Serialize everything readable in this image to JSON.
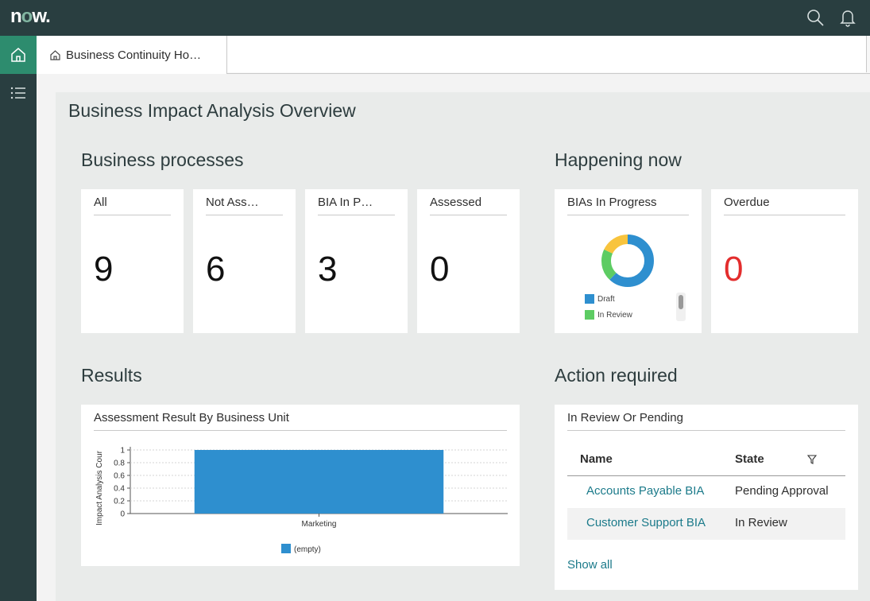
{
  "header": {
    "logo": {
      "n": "n",
      "o": "o",
      "w": "w."
    },
    "icons": [
      "search-icon",
      "bell-icon"
    ]
  },
  "rail": {
    "items": [
      "home-icon",
      "list-icon"
    ]
  },
  "tab": {
    "label": "Business Continuity Ho…"
  },
  "page": {
    "title": "Business Impact Analysis Overview"
  },
  "business_processes": {
    "title": "Business processes",
    "cards": [
      {
        "label": "All",
        "value": "9"
      },
      {
        "label": "Not Ass…",
        "value": "6"
      },
      {
        "label": "BIA In P…",
        "value": "3"
      },
      {
        "label": "Assessed",
        "value": "0"
      }
    ]
  },
  "happening_now": {
    "title": "Happening now",
    "bias_in_progress": {
      "label": "BIAs In Progress",
      "legend": [
        "Draft",
        "In Review"
      ]
    },
    "overdue": {
      "label": "Overdue",
      "value": "0"
    }
  },
  "results": {
    "title": "Results",
    "card_title": "Assessment Result By Business Unit",
    "chart_data": {
      "type": "bar",
      "categories": [
        "Marketing"
      ],
      "series": [
        {
          "name": "(empty)",
          "values": [
            1
          ]
        }
      ],
      "ylabel": "Impact Analysis Cour",
      "ylim": [
        0,
        1
      ],
      "yticks": [
        "0",
        "0.2",
        "0.4",
        "0.6",
        "0.8",
        "1"
      ],
      "grid": true,
      "legend": "bottom"
    }
  },
  "action_required": {
    "title": "Action required",
    "card_title": "In Review Or Pending",
    "columns": [
      "Name",
      "State"
    ],
    "rows": [
      {
        "name": "Accounts Payable BIA",
        "state": "Pending Approval"
      },
      {
        "name": "Customer Support BIA",
        "state": "In Review"
      }
    ],
    "show_all": "Show all"
  },
  "donut": {
    "type": "pie",
    "segments": [
      {
        "name": "Draft",
        "color": "#2e8fcf",
        "value": 0.62
      },
      {
        "name": "In Review",
        "color": "#5dcc63",
        "value": 0.2
      },
      {
        "name": "",
        "color": "#f8c43d",
        "value": 0.18
      }
    ]
  },
  "colors": {
    "accent": "#2d8c6e",
    "header": "#293e40",
    "link": "#1b7a8a",
    "bar": "#2e8fcf",
    "overdue": "#e32d2d"
  }
}
